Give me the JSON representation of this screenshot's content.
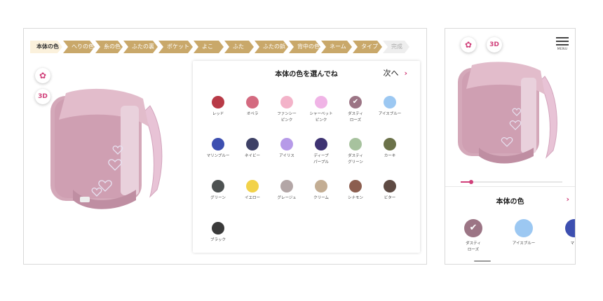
{
  "steps": [
    "本体の色",
    "へりの色",
    "糸の色",
    "ふたの裏",
    "ポケット",
    "よこ",
    "ふた",
    "ふたの鋲",
    "背中の色",
    "ネーム",
    "タイプ",
    "完成"
  ],
  "buttons": {
    "gear_icon": "gear-icon",
    "three_d": "3D",
    "next": "次へ",
    "menu": "MENU"
  },
  "panel": {
    "title": "本体の色を選んでね"
  },
  "colors": [
    {
      "name": "レッド",
      "hex": "#b83a47"
    },
    {
      "name": "オペラ",
      "hex": "#d46a80"
    },
    {
      "name": "ファンシー\nピンク",
      "hex": "#f3b3c9"
    },
    {
      "name": "シャーベット\nピンク",
      "hex": "#f0b4e6"
    },
    {
      "name": "ダスティ\nローズ",
      "hex": "#9c7585",
      "selected": true
    },
    {
      "name": "アイスブルー",
      "hex": "#9cc8f2"
    },
    {
      "name": "マリンブルー",
      "hex": "#3d4fb0"
    },
    {
      "name": "ネイビー",
      "hex": "#3e4166"
    },
    {
      "name": "アイリス",
      "hex": "#b69ae8"
    },
    {
      "name": "ディープ\nパープル",
      "hex": "#3e3372"
    },
    {
      "name": "ダスティ\nグリーン",
      "hex": "#a7c29e"
    },
    {
      "name": "カーキ",
      "hex": "#6b7249"
    },
    {
      "name": "グリーン",
      "hex": "#4e5252"
    },
    {
      "name": "イエロー",
      "hex": "#f2d24a"
    },
    {
      "name": "グレージュ",
      "hex": "#b3a6a6"
    },
    {
      "name": "クリーム",
      "hex": "#c3ad93"
    },
    {
      "name": "シナモン",
      "hex": "#8c5e4f"
    },
    {
      "name": "ビター",
      "hex": "#5e4a43"
    },
    {
      "name": "ブラック",
      "hex": "#3a3a3a"
    }
  ],
  "mobile": {
    "panel_title": "本体の色",
    "colors": [
      {
        "name": "ダスティ\nローズ",
        "hex": "#9c7585",
        "selected": true
      },
      {
        "name": "アイスブルー",
        "hex": "#9cc8f2"
      },
      {
        "name": "マリ",
        "hex": "#3d4fb0"
      }
    ],
    "slider_fraction": 0.1
  },
  "accent": "#d0407a",
  "bag_color": "#d4a8b9"
}
